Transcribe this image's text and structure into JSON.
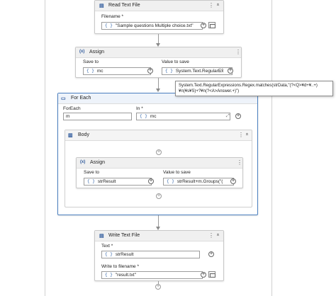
{
  "read_text_file": {
    "title": "Read Text File",
    "filename_label": "Filename *",
    "filename_value": "\"Sample questions Multiple choice.txt\""
  },
  "assign1": {
    "title": "Assign",
    "save_to_label": "Save to",
    "value_to_save_label": "Value to save",
    "save_to_value": "mc",
    "value_to_save_value": "System.Text.RegularEx"
  },
  "tooltip": {
    "text": "System.Text.RegularExpressions.Regex.matches(strData,\"(?<Q>¥d+¥..+)¥n(¥s¥S)+?¥n(?<A>Answer.+)\")"
  },
  "for_each": {
    "title": "For Each",
    "foreach_label": "ForEach",
    "foreach_value": "m",
    "in_label": "In *",
    "in_value": "mc"
  },
  "body": {
    "title": "Body"
  },
  "assign2": {
    "title": "Assign",
    "save_to_label": "Save to",
    "value_to_save_label": "Value to save",
    "save_to_value": "strResult",
    "value_to_save_value": "strResult+m.Groups(\"("
  },
  "write_text_file": {
    "title": "Write Text File",
    "text_label": "Text *",
    "text_value": "strResult",
    "write_to_label": "Write to filename *",
    "write_to_value": "\"result.txt\""
  },
  "icons": {
    "brace": "{ }",
    "more": "⋮",
    "collapse": "«",
    "plus": "+",
    "expand": "⤢",
    "assign": "(x)",
    "file": "▤"
  }
}
